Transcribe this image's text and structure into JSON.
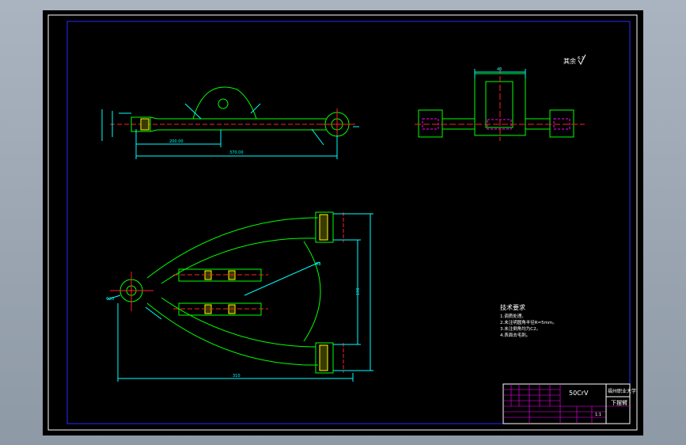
{
  "drawing": {
    "roughness_mark": "其余",
    "roughness_value": "6.3",
    "tech_requirements": {
      "title": "技术要求",
      "items": [
        "1.调质处理。",
        "2.未注明圆角半径R=5mm。",
        "3.未注倒角均为C2。",
        "4.表面去毛刺。"
      ]
    },
    "title_block": {
      "material": "50CrV",
      "school": "福州职业大学",
      "part_name": "下摆臂",
      "scale": "1:1"
    },
    "dimensions": {
      "overall_length": "370.00",
      "rod_length": "200.00",
      "top_width": "40",
      "span_width": "310",
      "arm_height": "190",
      "fillet_radius": "R8",
      "bore_dia": "Φ20"
    }
  },
  "colors": {
    "background": "#000000",
    "outline": "#00ff00",
    "dimension": "#00ffff",
    "centerline": "#ff2020",
    "hatch": "#ffff00",
    "border": "#0000ff",
    "title_grid": "#ff00ff",
    "text": "#ffffff"
  }
}
